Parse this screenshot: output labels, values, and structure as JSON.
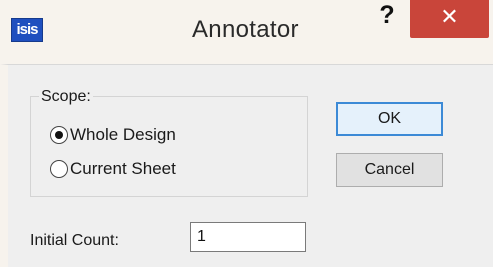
{
  "window": {
    "title": "Annotator",
    "app_icon_text": "isis",
    "help_label": "?",
    "close_label": "✕",
    "close_color": "#c9453a"
  },
  "scope": {
    "legend": "Scope:",
    "options": [
      {
        "label": "Whole Design",
        "checked": true
      },
      {
        "label": "Current Sheet",
        "checked": false
      }
    ]
  },
  "buttons": {
    "ok_label": "OK",
    "cancel_label": "Cancel"
  },
  "initial_count": {
    "label": "Initial Count:",
    "value": "1"
  }
}
